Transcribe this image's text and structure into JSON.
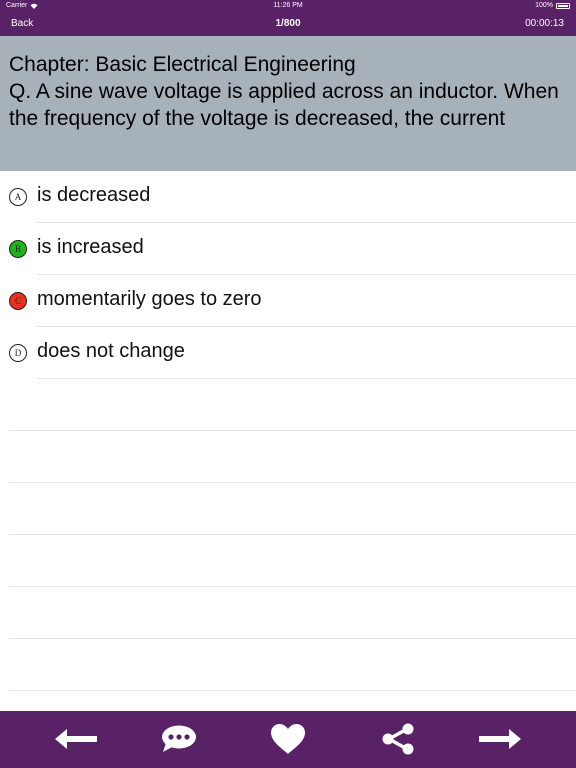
{
  "status": {
    "carrier": "Carrier",
    "time": "11:26 PM",
    "battery": "100%"
  },
  "nav": {
    "back_label": "Back",
    "counter": "1/800",
    "timer": "00:00:13"
  },
  "question": {
    "chapter": "Chapter: Basic Electrical Engineering",
    "text": "Q. A sine wave voltage is applied across an inductor. When the frequency of the voltage is decreased, the current"
  },
  "options": [
    {
      "letter": "A",
      "text": "is decreased",
      "state": "none",
      "color": "#ffffff"
    },
    {
      "letter": "B",
      "text": "is increased",
      "state": "correct",
      "color": "#1cb51c"
    },
    {
      "letter": "C",
      "text": "momentarily goes to zero",
      "state": "wrong",
      "color": "#e8321e"
    },
    {
      "letter": "D",
      "text": "does not change",
      "state": "none",
      "color": "#ffffff"
    }
  ],
  "toolbar": {
    "icons": [
      "arrow-left-icon",
      "comment-icon",
      "heart-icon",
      "share-icon",
      "arrow-right-icon"
    ]
  },
  "colors": {
    "bar": "#5a2266",
    "question_bg": "#a7b1ba",
    "correct": "#1cb51c",
    "wrong": "#e8321e"
  }
}
